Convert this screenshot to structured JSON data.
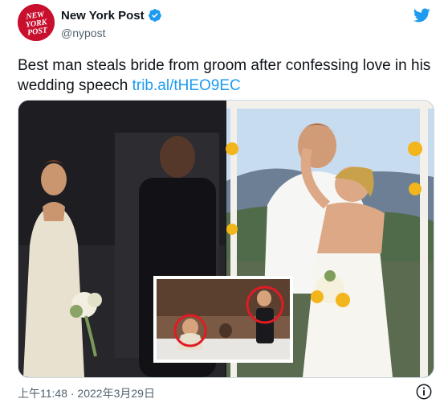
{
  "account": {
    "name": "New York Post",
    "handle": "@nypost",
    "avatar_lines": [
      "NEW",
      "YORK",
      "POST"
    ]
  },
  "tweet": {
    "text": "Best man steals bride from groom after confessing love in his wedding speech",
    "link": "trib.al/tHEO9EC",
    "timestamp": "上午11:48 · 2022年3月29日"
  },
  "icons": {
    "verified": "verified-badge-icon",
    "twitter": "twitter-bird-icon",
    "info": "info-icon"
  },
  "colors": {
    "accent": "#1d9bf0",
    "brand": "#c8102e",
    "text": "#0f1419",
    "muted": "#536471"
  }
}
